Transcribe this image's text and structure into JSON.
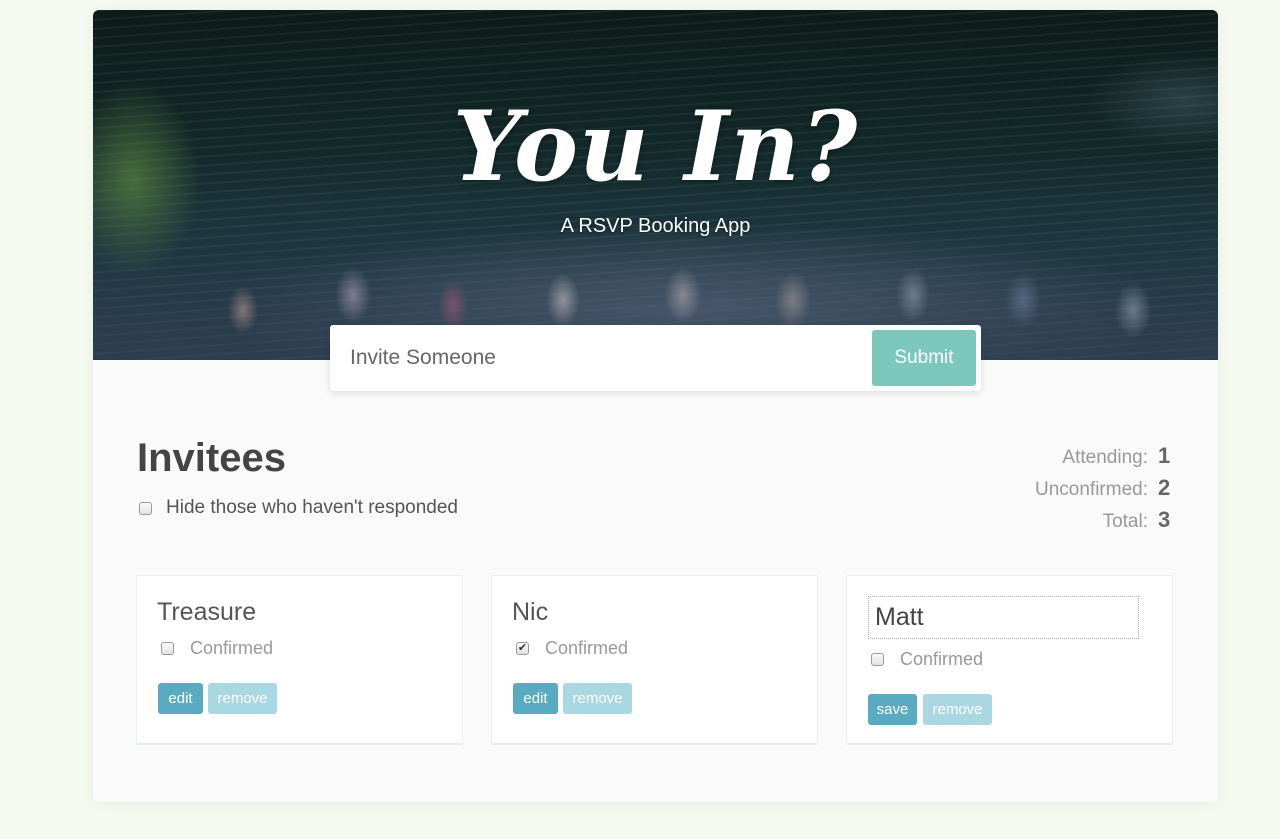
{
  "hero": {
    "title": "You In?",
    "subtitle": "A RSVP Booking App"
  },
  "invite_form": {
    "placeholder": "Invite Someone",
    "value": "",
    "submit_label": "Submit"
  },
  "invitees": {
    "title": "Invitees",
    "filter_label": "Hide those who haven't responded",
    "filter_checked": false
  },
  "counter": {
    "attending_label": "Attending:",
    "attending": "1",
    "unconfirmed_label": "Unconfirmed:",
    "unconfirmed": "2",
    "total_label": "Total:",
    "total": "3"
  },
  "guests": [
    {
      "name": "Treasure",
      "confirmed": false,
      "confirmed_label": "Confirmed",
      "action_label": "edit",
      "remove_label": "remove",
      "editing": false
    },
    {
      "name": "Nic",
      "confirmed": true,
      "confirmed_label": "Confirmed",
      "action_label": "edit",
      "remove_label": "remove",
      "editing": false
    },
    {
      "name": "Matt",
      "confirmed": false,
      "confirmed_label": "Confirmed",
      "action_label": "save",
      "remove_label": "remove",
      "editing": true
    }
  ],
  "colors": {
    "accent": "#7dc8bd",
    "button": "#5aabc2",
    "button_light": "#a9d7e2"
  }
}
